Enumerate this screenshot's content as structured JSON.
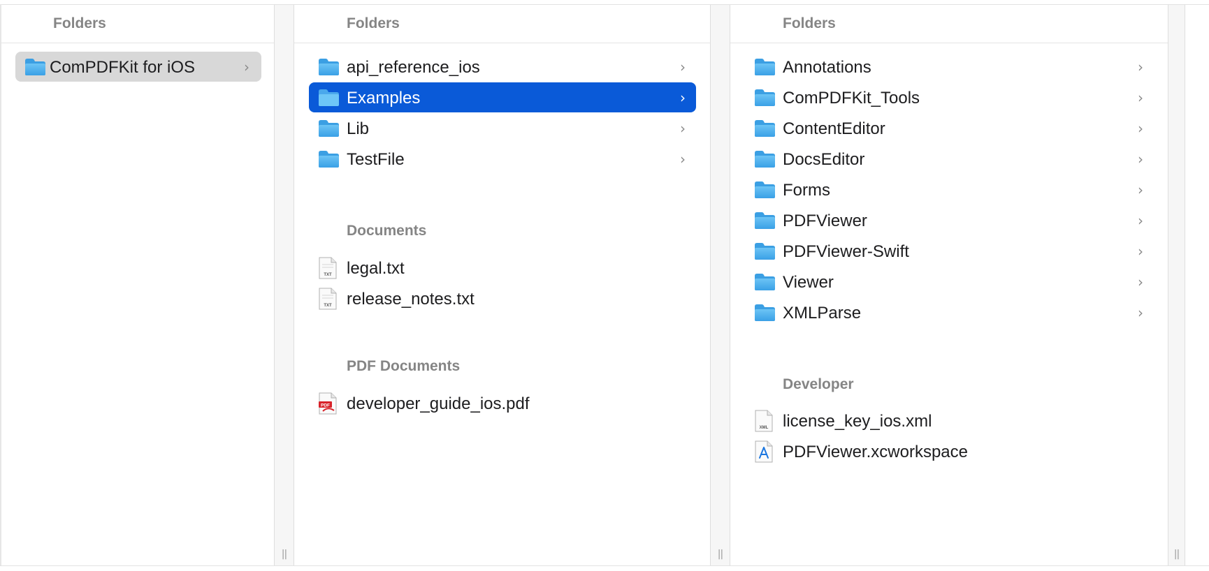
{
  "column1": {
    "header": "Folders",
    "items": [
      {
        "label": "ComPDFKit for iOS",
        "icon": "folder-icon",
        "chevron": "›"
      }
    ]
  },
  "column2": {
    "header": "Folders",
    "folders": [
      {
        "label": "api_reference_ios",
        "icon": "folder-icon",
        "chevron": "›"
      },
      {
        "label": "Examples",
        "icon": "folder-icon",
        "chevron": "›"
      },
      {
        "label": "Lib",
        "icon": "folder-icon",
        "chevron": "›"
      },
      {
        "label": "TestFile",
        "icon": "folder-icon",
        "chevron": "›"
      }
    ],
    "documents_header": "Documents",
    "documents": [
      {
        "label": "legal.txt",
        "icon": "txt-file-icon",
        "badge": "TXT"
      },
      {
        "label": "release_notes.txt",
        "icon": "txt-file-icon",
        "badge": "TXT"
      }
    ],
    "pdf_header": "PDF Documents",
    "pdfs": [
      {
        "label": "developer_guide_ios.pdf",
        "icon": "pdf-file-icon",
        "badge": "PDF"
      }
    ]
  },
  "column3": {
    "header": "Folders",
    "folders": [
      {
        "label": "Annotations",
        "icon": "folder-icon",
        "chevron": "›"
      },
      {
        "label": "ComPDFKit_Tools",
        "icon": "folder-icon",
        "chevron": "›"
      },
      {
        "label": "ContentEditor",
        "icon": "folder-icon",
        "chevron": "›"
      },
      {
        "label": "DocsEditor",
        "icon": "folder-icon",
        "chevron": "›"
      },
      {
        "label": "Forms",
        "icon": "folder-icon",
        "chevron": "›"
      },
      {
        "label": "PDFViewer",
        "icon": "folder-icon",
        "chevron": "›"
      },
      {
        "label": "PDFViewer-Swift",
        "icon": "folder-icon",
        "chevron": "›"
      },
      {
        "label": "Viewer",
        "icon": "folder-icon",
        "chevron": "›"
      },
      {
        "label": "XMLParse",
        "icon": "folder-icon",
        "chevron": "›"
      }
    ],
    "developer_header": "Developer",
    "developer": [
      {
        "label": "license_key_ios.xml",
        "icon": "xml-file-icon",
        "badge": "XML"
      },
      {
        "label": "PDFViewer.xcworkspace",
        "icon": "xcworkspace-icon"
      }
    ]
  },
  "resize_handle": "||",
  "colors": {
    "selection": "#0a5ad8",
    "inactive_selection": "#d8d8d8",
    "folder_blue": "#5ab6f0",
    "section_header": "#858585"
  }
}
